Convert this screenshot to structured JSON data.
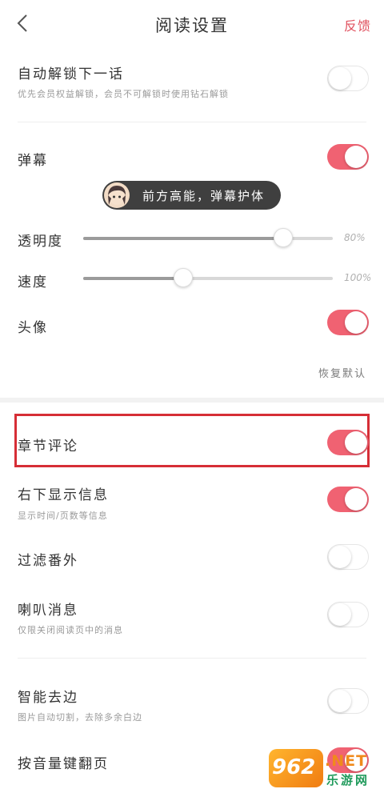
{
  "header": {
    "title": "阅读设置",
    "feedback": "反馈"
  },
  "auto_unlock": {
    "label": "自动解锁下一话",
    "desc": "优先会员权益解锁，会员不可解锁时使用钻石解锁",
    "enabled": false
  },
  "danmaku": {
    "label": "弹幕",
    "enabled": true,
    "preview_text": "前方高能，弹幕护体"
  },
  "opacity": {
    "label": "透明度",
    "value": 80,
    "value_text": "80%"
  },
  "speed": {
    "label": "速度",
    "value": 40,
    "value_text": "100%"
  },
  "avatar": {
    "label": "头像",
    "enabled": true
  },
  "reset": {
    "label": "恢复默认"
  },
  "chapter_comment": {
    "label": "章节评论",
    "enabled": true
  },
  "bottom_info": {
    "label": "右下显示信息",
    "desc": "显示时间/页数等信息",
    "enabled": true
  },
  "filter_extra": {
    "label": "过滤番外",
    "enabled": false
  },
  "horn_msg": {
    "label": "喇叭消息",
    "desc": "仅限关闭阅读页中的消息",
    "enabled": false
  },
  "smart_crop": {
    "label": "智能去边",
    "desc": "图片自动切割，去除多余白边",
    "enabled": false
  },
  "volume_flip": {
    "label": "按音量键翻页",
    "enabled": true
  },
  "watermark": {
    "logo_text": "962",
    "domain": ".NET",
    "site": "乐游网"
  },
  "colors": {
    "accent": "#f06272",
    "highlight": "#d62e36"
  }
}
